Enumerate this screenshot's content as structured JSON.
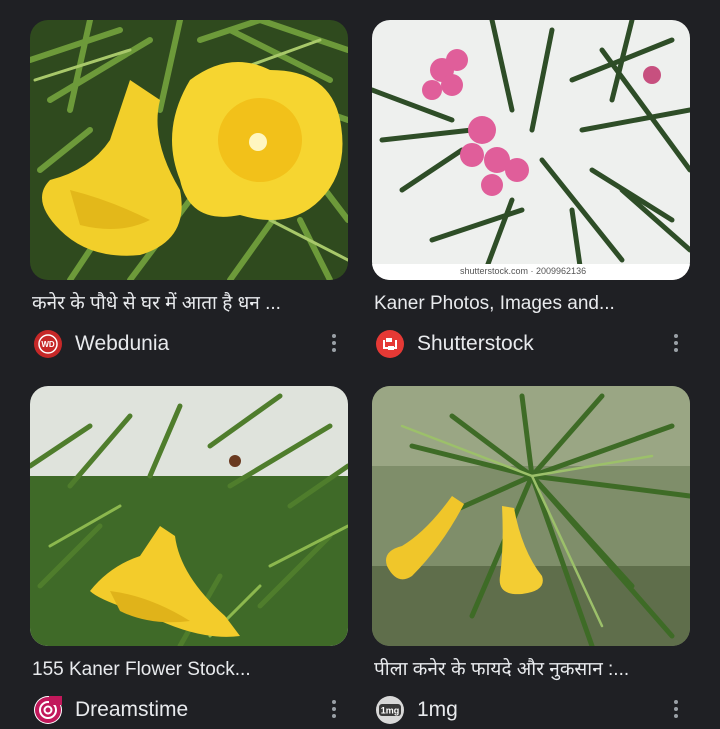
{
  "results": [
    {
      "caption": "कनेर के पौधे से घर में आता है धन ...",
      "source": "Webdunia",
      "favicon_text": "WD",
      "favicon_icon": "webdunia-logo-icon",
      "favicon_color": "#c62828"
    },
    {
      "caption": "Kaner Photos, Images and...",
      "source": "Shutterstock",
      "favicon_icon": "shutterstock-logo-icon",
      "favicon_color": "#e53935",
      "watermark": "shutterstock.com · 2009962136"
    },
    {
      "caption": "155 Kaner Flower Stock...",
      "source": "Dreamstime",
      "favicon_icon": "dreamstime-logo-icon",
      "favicon_color": "#c2185b"
    },
    {
      "caption": "पीला कनेर के फायदे और नुकसान :...",
      "source": "1mg",
      "favicon_text": "1mg",
      "favicon_icon": "1mg-logo-icon",
      "favicon_color": "#d8d8d8"
    }
  ],
  "colors": {
    "background": "#1f2024",
    "text": "#e8eaed",
    "more_dots": "#9aa0a6"
  }
}
